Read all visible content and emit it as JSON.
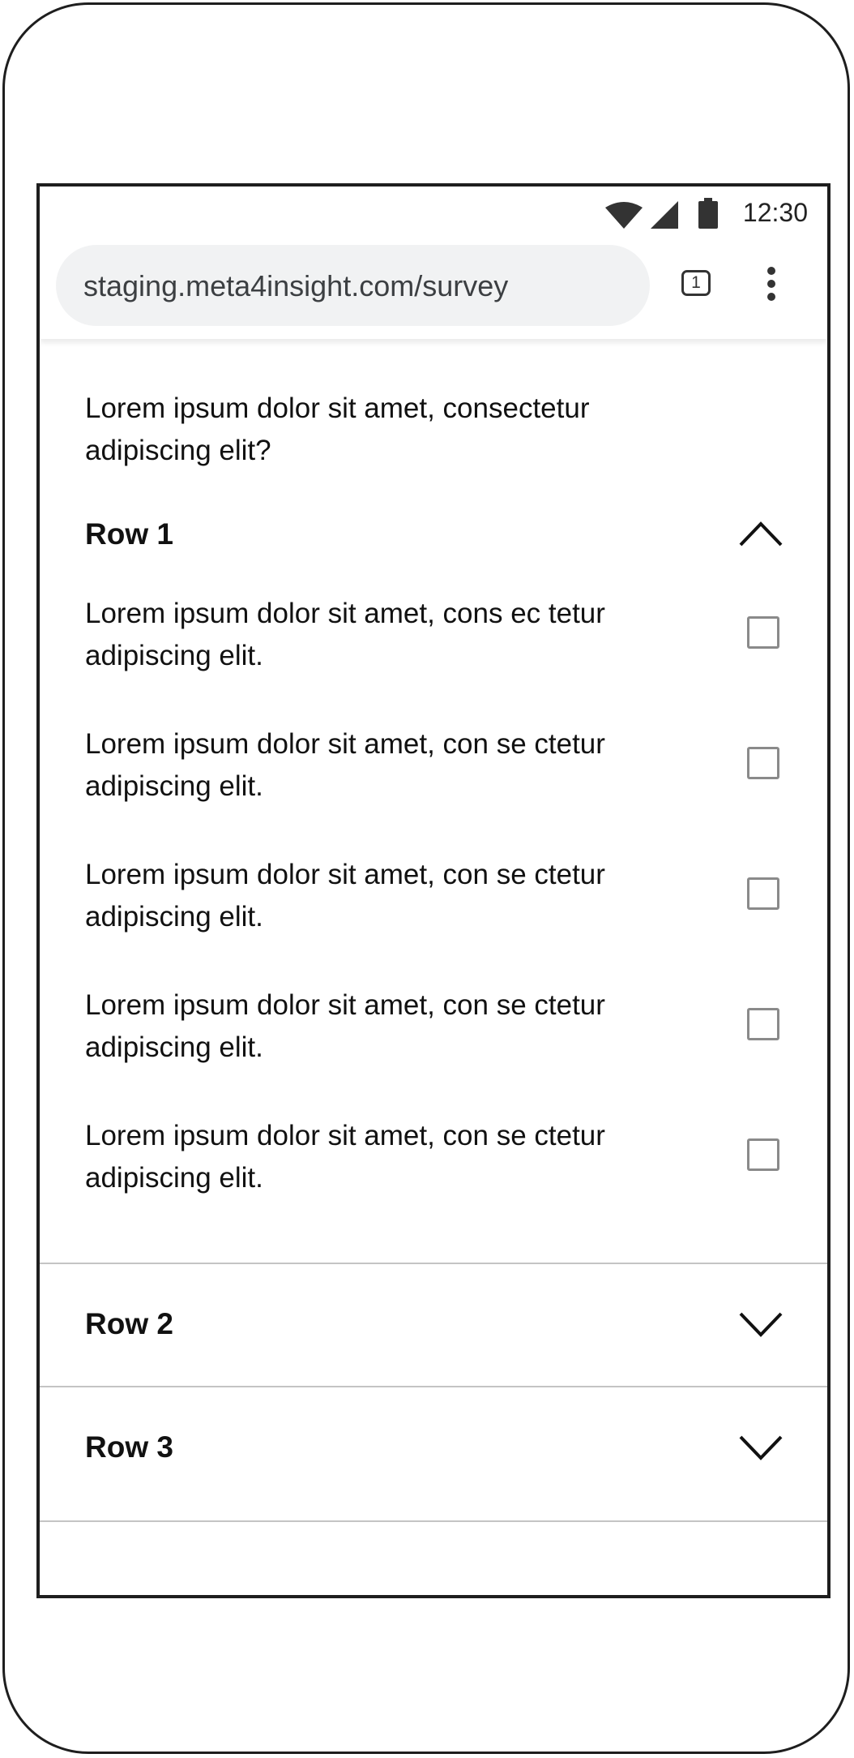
{
  "status_bar": {
    "time": "12:30",
    "icons": [
      "wifi-icon",
      "signal-icon",
      "battery-icon"
    ]
  },
  "browser": {
    "url": "staging.meta4insight.com/survey",
    "tab_count": "1",
    "menu_icon": "more-vert-icon"
  },
  "survey": {
    "question": "Lorem ipsum dolor sit amet, consectetur adipiscing elit?",
    "rows": [
      {
        "title": "Row 1",
        "expanded": true,
        "options": [
          {
            "label": "Lorem ipsum dolor sit amet, cons ec tetur adipiscing elit.",
            "checked": false
          },
          {
            "label": "Lorem ipsum dolor sit amet, con se ctetur adipiscing elit.",
            "checked": false
          },
          {
            "label": "Lorem ipsum dolor sit amet, con se ctetur adipiscing elit.",
            "checked": false
          },
          {
            "label": "Lorem ipsum dolor sit amet, con se ctetur adipiscing elit.",
            "checked": false
          },
          {
            "label": "Lorem ipsum dolor sit amet, con se ctetur adipiscing elit.",
            "checked": false
          }
        ]
      },
      {
        "title": "Row 2",
        "expanded": false
      },
      {
        "title": "Row 3",
        "expanded": false
      }
    ]
  }
}
